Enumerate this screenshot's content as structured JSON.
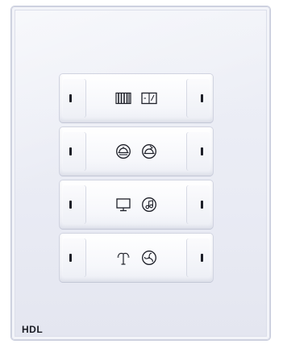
{
  "brand": {
    "text": "HDL"
  },
  "keys": [
    {
      "icons": [
        "curtain-icon",
        "window-icon"
      ]
    },
    {
      "icons": [
        "sunset-icon",
        "sunrise-icon"
      ]
    },
    {
      "icons": [
        "monitor-icon",
        "music-icon"
      ]
    },
    {
      "icons": [
        "lamp-icon",
        "fan-icon"
      ]
    }
  ]
}
